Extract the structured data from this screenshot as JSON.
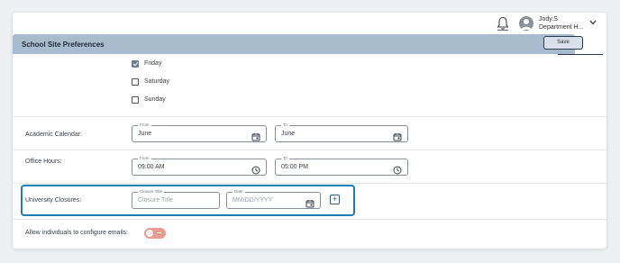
{
  "user": {
    "name": "Jody.S",
    "role": "Department H..."
  },
  "header": {
    "title": "School Site Preferences",
    "save_label": "Save"
  },
  "days": [
    {
      "label": "Friday",
      "checked": true
    },
    {
      "label": "Saturday",
      "checked": false
    },
    {
      "label": "Sunday",
      "checked": false
    }
  ],
  "academic_calendar": {
    "label": "Academic Calendar:",
    "from_legend": "From",
    "from_value": "June",
    "to_legend": "To",
    "to_value": "June"
  },
  "office_hours": {
    "label": "Office Hours:",
    "from_legend": "From",
    "from_value": "09:00 AM",
    "to_legend": "To",
    "to_value": "05:00 PM"
  },
  "university_closures": {
    "label": "University Closures:",
    "title_legend": "Closure Title",
    "title_placeholder": "Closure Title",
    "date_legend": "Date",
    "date_placeholder": "MM/DD/YYYY",
    "add_label": "+"
  },
  "emails": {
    "label": "Allow individuals to configure emails:",
    "enabled": false
  },
  "colors": {
    "header_bg": "#a9bccf",
    "highlight": "#1b7cb8",
    "toggle_off": "#e79b91"
  }
}
